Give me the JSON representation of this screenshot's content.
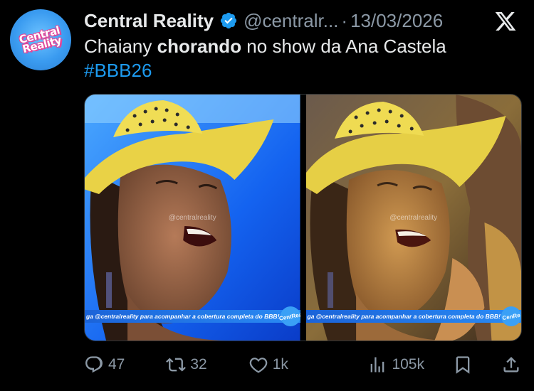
{
  "author": {
    "display_name": "Central Reality",
    "handle": "@centralr...",
    "separator": "·",
    "timestamp": "13/03/2026",
    "avatar_text": [
      "Central",
      "Reality"
    ]
  },
  "tweet": {
    "text_before": "Chaiany ",
    "text_bold": "chorando",
    "text_after": " no show da Ana Castela",
    "hashtag": "#BBB26"
  },
  "media": {
    "photos": [
      {
        "watermark": "@centralreality",
        "ticker": "ga @centralreality para acompanhar a cobertura completa do BBB!",
        "badge_lines": [
          "Cent",
          "Rea"
        ]
      },
      {
        "watermark": "@centralreality",
        "ticker": "ga @centralreality para acompanhar a cobertura completa do BBB!",
        "badge_lines": [
          "Cen",
          "Re"
        ]
      }
    ]
  },
  "actions": {
    "replies": "47",
    "reposts": "32",
    "likes": "1k",
    "views": "105k"
  },
  "icons": {
    "verified": "verified-badge-icon",
    "platform": "x-logo-icon",
    "reply": "reply-icon",
    "repost": "repost-icon",
    "like": "like-icon",
    "views": "views-icon",
    "bookmark": "bookmark-icon",
    "share": "share-icon"
  },
  "colors": {
    "background": "#000000",
    "text": "#e7e9ea",
    "muted": "#8b98a5",
    "accent": "#1d9bf0"
  }
}
